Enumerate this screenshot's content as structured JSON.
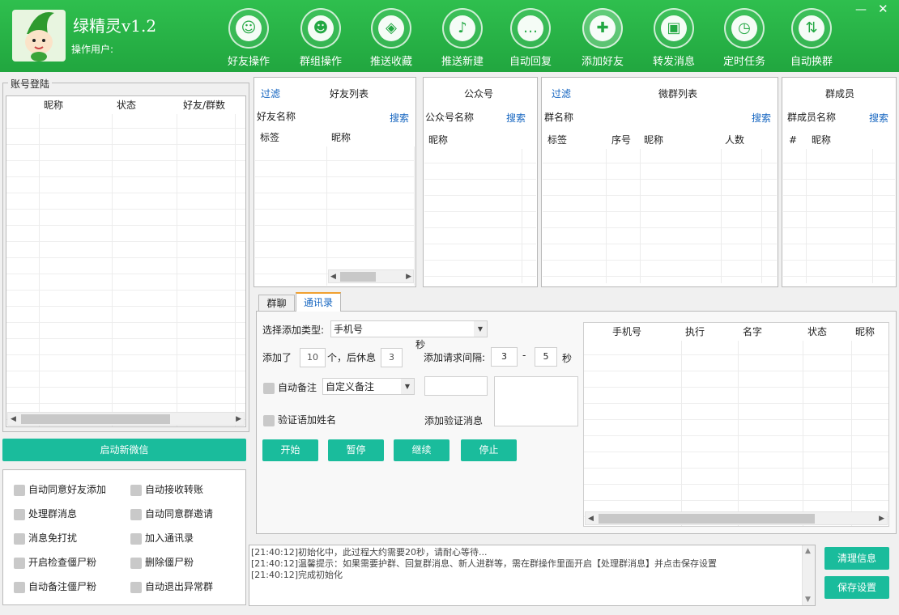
{
  "header": {
    "app_title": "绿精灵v1.2",
    "operator_label": "操作用户:",
    "nav": [
      {
        "label": "好友操作",
        "icon": "friend-icon",
        "glyph": "☺"
      },
      {
        "label": "群组操作",
        "icon": "group-icon",
        "glyph": "☻"
      },
      {
        "label": "推送收藏",
        "icon": "tag-icon",
        "glyph": "◈"
      },
      {
        "label": "推送新建",
        "icon": "bell-icon",
        "glyph": "♪"
      },
      {
        "label": "自动回复",
        "icon": "chat-icon",
        "glyph": "…"
      },
      {
        "label": "添加好友",
        "icon": "add-user-icon",
        "glyph": "✚"
      },
      {
        "label": "转发消息",
        "icon": "contact-card-icon",
        "glyph": "▣"
      },
      {
        "label": "定时任务",
        "icon": "clock-icon",
        "glyph": "◷"
      },
      {
        "label": "自动换群",
        "icon": "phone-switch-icon",
        "glyph": "⇅"
      }
    ],
    "window_controls": {
      "minimize": "—",
      "close": "✕"
    }
  },
  "account": {
    "title": "账号登陆",
    "columns": [
      "昵称",
      "状态",
      "好友/群数"
    ],
    "start_button": "启动新微信"
  },
  "options": [
    {
      "label": "自动同意好友添加",
      "checked": false
    },
    {
      "label": "自动接收转账",
      "checked": false
    },
    {
      "label": "处理群消息",
      "checked": false
    },
    {
      "label": "自动同意群邀请",
      "checked": false
    },
    {
      "label": "消息免打扰",
      "checked": false
    },
    {
      "label": "加入通讯录",
      "checked": false
    },
    {
      "label": "开启检查僵尸粉",
      "checked": false
    },
    {
      "label": "删除僵尸粉",
      "checked": false
    },
    {
      "label": "自动备注僵尸粉",
      "checked": false
    },
    {
      "label": "自动退出异常群",
      "checked": false
    }
  ],
  "friends": {
    "filter": "过滤",
    "title": "好友列表",
    "search_label": "好友名称",
    "search": "搜索",
    "col_tag": "标签",
    "col_nick": "昵称"
  },
  "official": {
    "title": "公众号",
    "search_label": "公众号名称",
    "search": "搜索",
    "col_nick": "昵称"
  },
  "groups": {
    "filter": "过滤",
    "title": "微群列表",
    "search_label": "群名称",
    "search": "搜索",
    "col_tag": "标签",
    "col_no": "序号",
    "col_nick": "昵称",
    "col_count": "人数"
  },
  "members": {
    "title": "群成员",
    "search_label": "群成员名称",
    "search": "搜索",
    "col_hash": "#",
    "col_nick": "昵称"
  },
  "tabs": [
    {
      "label": "群聊",
      "active": false
    },
    {
      "label": "通讯录",
      "active": true
    }
  ],
  "addform": {
    "type_label": "选择添加类型:",
    "type_value": "手机号",
    "added_label": "添加了",
    "added_value": "10",
    "rest_label": "个，后休息",
    "rest_value": "3",
    "sec": "秒",
    "interval_label": "添加请求间隔:",
    "interval_min": "3",
    "dash": "-",
    "interval_max": "5",
    "sec2": "秒",
    "auto_remark": "自动备注",
    "remark_mode": "自定义备注",
    "verify_name": "验证语加姓名",
    "verify_msg_label": "添加验证消息",
    "buttons": [
      "开始",
      "暂停",
      "继续",
      "停止"
    ]
  },
  "result_table": {
    "columns": [
      "手机号",
      "执行",
      "名字",
      "状态",
      "昵称"
    ]
  },
  "log": [
    "[21:40:12]初始化中，此过程大约需要20秒，请耐心等待...",
    "[21:40:12]温馨提示：如果需要护群、回复群消息、新人进群等，需在群操作里面开启【处理群消息】并点击保存设置",
    "[21:40:12]完成初始化"
  ],
  "side_buttons": {
    "clear": "清理信息",
    "save": "保存设置"
  }
}
